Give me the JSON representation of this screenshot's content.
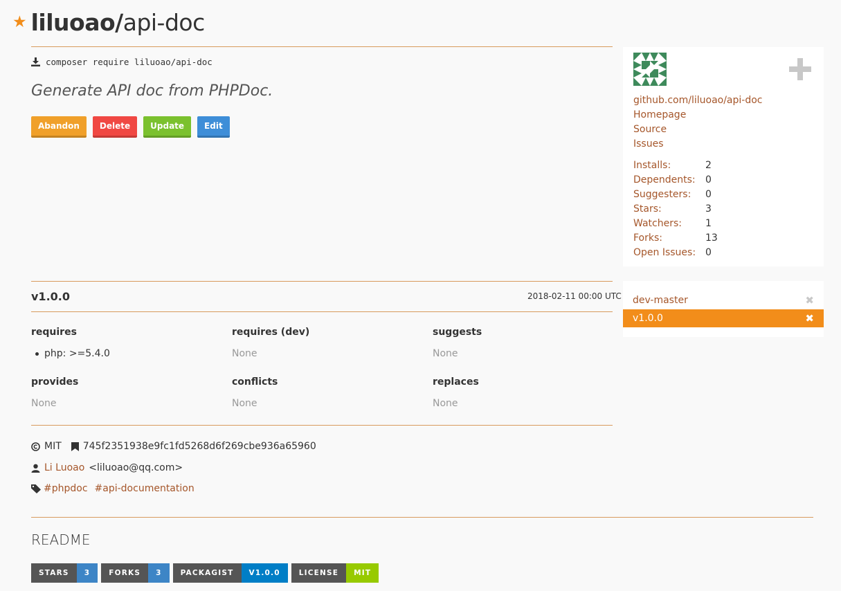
{
  "header": {
    "vendor": "liluoao/",
    "name": "api-doc",
    "favorite_icon": "star-icon"
  },
  "install": {
    "icon": "download-icon",
    "command": "composer require liluoao/api-doc"
  },
  "description": "Generate API doc from PHPDoc.",
  "actions": [
    {
      "label": "Abandon",
      "color": "#f0a02a"
    },
    {
      "label": "Delete",
      "color": "#f04843"
    },
    {
      "label": "Update",
      "color": "#7bc12e"
    },
    {
      "label": "Edit",
      "color": "#3e8ed8"
    }
  ],
  "sidebar": {
    "avatar_icon": "identicon-avatar",
    "add_icon": "plus-icon",
    "links": [
      "github.com/liluoao/api-doc",
      "Homepage",
      "Source",
      "Issues"
    ],
    "stats": [
      {
        "label": "Installs:",
        "value": "2"
      },
      {
        "label": "Dependents:",
        "value": "0"
      },
      {
        "label": "Suggesters:",
        "value": "0"
      },
      {
        "label": "Stars:",
        "value": "3"
      },
      {
        "label": "Watchers:",
        "value": "1"
      },
      {
        "label": "Forks:",
        "value": "13"
      },
      {
        "label": "Open Issues:",
        "value": "0"
      }
    ],
    "versions": [
      {
        "label": "dev-master",
        "active": false
      },
      {
        "label": "v1.0.0",
        "active": true
      }
    ]
  },
  "version": {
    "title": "v1.0.0",
    "date": "2018-02-11 00:00 UTC",
    "requires": {
      "heading": "requires",
      "items": [
        "php: >=5.4.0"
      ]
    },
    "requires_dev": {
      "heading": "requires (dev)",
      "none": "None"
    },
    "suggests": {
      "heading": "suggests",
      "none": "None"
    },
    "provides": {
      "heading": "provides",
      "none": "None"
    },
    "conflicts": {
      "heading": "conflicts",
      "none": "None"
    },
    "replaces": {
      "heading": "replaces",
      "none": "None"
    }
  },
  "meta": {
    "license": "MIT",
    "reference": "745f2351938e9fc1fd5268d6f269cbe936a65960",
    "author_name": "Li Luoao",
    "author_email": "<liluoao@qq.com>",
    "tags": [
      "#phpdoc",
      "#api-documentation"
    ]
  },
  "readme": {
    "title": "README",
    "badges": [
      {
        "left": "STARS",
        "right": "3",
        "color": "#3d85c6"
      },
      {
        "left": "FORKS",
        "right": "3",
        "color": "#3d85c6"
      },
      {
        "left": "PACKAGIST",
        "right": "V1.0.0",
        "color": "#007ec6"
      },
      {
        "left": "LICENSE",
        "right": "MIT",
        "color": "#97ca00"
      }
    ]
  },
  "colors": {
    "accent": "#f28d1a",
    "link": "#a5562a",
    "rule": "#d89a5d"
  }
}
